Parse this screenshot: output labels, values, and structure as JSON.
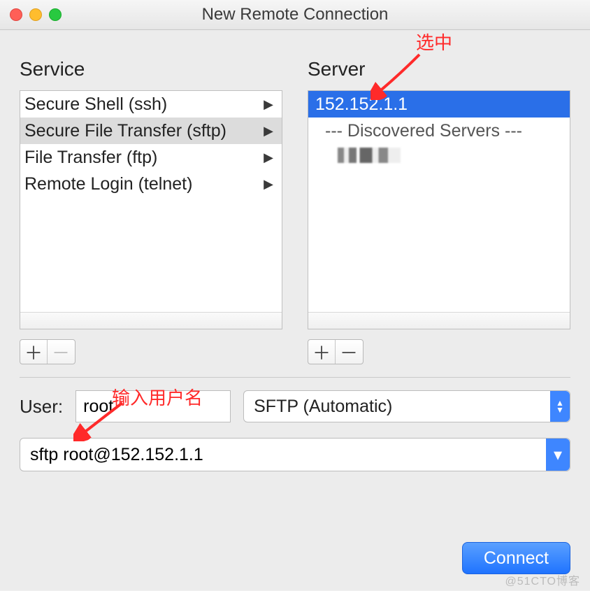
{
  "window": {
    "title": "New Remote Connection"
  },
  "headers": {
    "service": "Service",
    "server": "Server"
  },
  "services": [
    {
      "label": "Secure Shell (ssh)",
      "selected": false
    },
    {
      "label": "Secure File Transfer (sftp)",
      "selected": true
    },
    {
      "label": "File Transfer (ftp)",
      "selected": false
    },
    {
      "label": "Remote Login (telnet)",
      "selected": false
    }
  ],
  "servers": {
    "selected": "152.152.1.1",
    "discovered_header": "--- Discovered Servers ---"
  },
  "user_label": "User:",
  "user_value": "root",
  "protocol_selected": "SFTP (Automatic)",
  "command": "sftp root@152.152.1.1",
  "connect_label": "Connect",
  "annotations": {
    "select_server": "选中",
    "enter_username": "输入用户名"
  },
  "watermark": "@51CTO博客"
}
